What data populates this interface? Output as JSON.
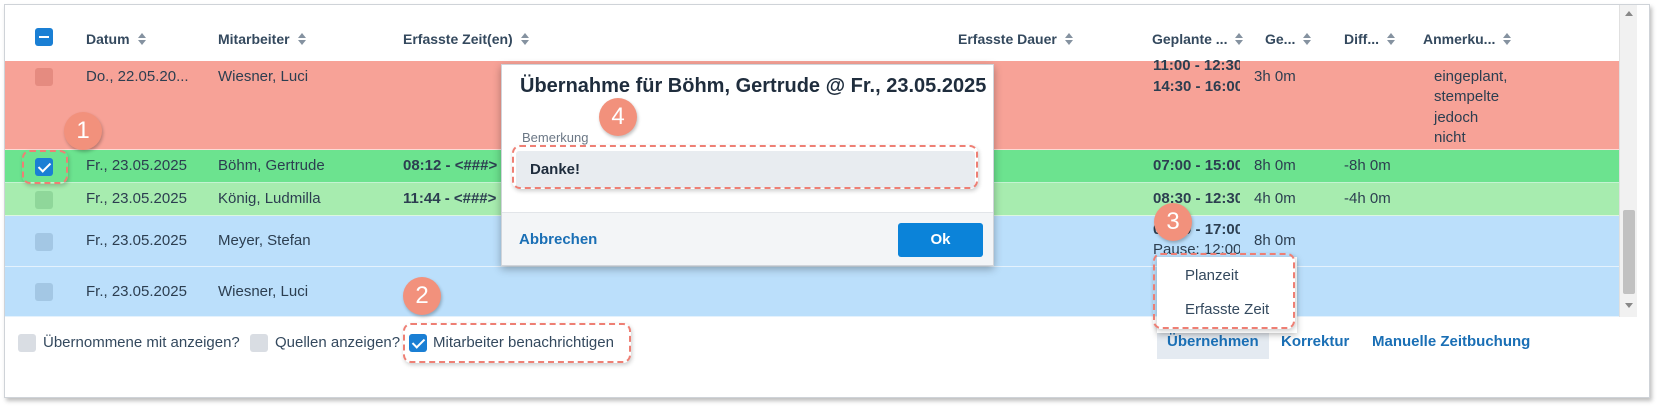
{
  "colors": {
    "row_red": "#f7a297",
    "row_green_dark": "#6ce38f",
    "row_green_light": "#a7ecaf",
    "row_blue": "#bbdffb",
    "accent": "#1a7fd4",
    "callout": "#f2917c"
  },
  "table": {
    "headers": {
      "datum": "Datum",
      "mitarbeiter": "Mitarbeiter",
      "erfasste_zeiten": "Erfasste Zeit(en)",
      "erfasste_dauer": "Erfasste Dauer",
      "geplante": "Geplante ...",
      "ge": "Ge...",
      "diff": "Diff...",
      "anmerkung": "Anmerku..."
    },
    "rows": [
      {
        "checked": false,
        "datum": "Do., 22.05.20...",
        "mitarbeiter": "Wiesner, Luci",
        "erfasste": "",
        "geplante_1": "11:00 - 12:30",
        "geplante_2": "14:30 - 16:00",
        "ge": "3h 0m",
        "diff": "",
        "anmerkung_1": "eingeplant,",
        "anmerkung_2": "stempelte",
        "anmerkung_3": "jedoch",
        "anmerkung_4": "nicht"
      },
      {
        "checked": true,
        "datum": "Fr., 23.05.2025",
        "mitarbeiter": "Böhm, Gertrude",
        "erfasste": "08:12 - <###>",
        "geplante_1": "07:00 - 15:00",
        "ge": "8h 0m",
        "diff": "-8h 0m"
      },
      {
        "checked": false,
        "datum": "Fr., 23.05.2025",
        "mitarbeiter": "König, Ludmilla",
        "erfasste": "11:44 - <###>",
        "geplante_1": "08:30 - 12:30",
        "ge": "4h 0m",
        "diff": "-4h 0m"
      },
      {
        "checked": false,
        "datum": "Fr., 23.05.2025",
        "mitarbeiter": "Meyer, Stefan",
        "erfasste": "",
        "geplante_1": "07:00 - 17:00",
        "geplante_2": "Pause: 12:00",
        "ge": "8h 0m",
        "diff": ""
      },
      {
        "checked": false,
        "datum": "Fr., 23.05.2025",
        "mitarbeiter": "Wiesner, Luci",
        "erfasste": "",
        "geplante_1": "",
        "ge": "",
        "diff": ""
      }
    ]
  },
  "footer": {
    "uebernommene": "Übernommene mit anzeigen?",
    "quellen": "Quellen anzeigen?",
    "benachrichtigen": "Mitarbeiter benachrichtigen",
    "uebernehmen": "Übernehmen",
    "korrektur": "Korrektur",
    "manuelle": "Manuelle Zeitbuchung"
  },
  "dropdown": {
    "items": [
      "Planzeit",
      "Erfasste Zeit"
    ]
  },
  "modal": {
    "title": "Übernahme für Böhm, Gertrude @ Fr., 23.05.2025",
    "label": "Bemerkung",
    "value": "Danke!",
    "cancel": "Abbrechen",
    "ok": "Ok"
  },
  "callouts": [
    "1",
    "2",
    "3",
    "4"
  ]
}
